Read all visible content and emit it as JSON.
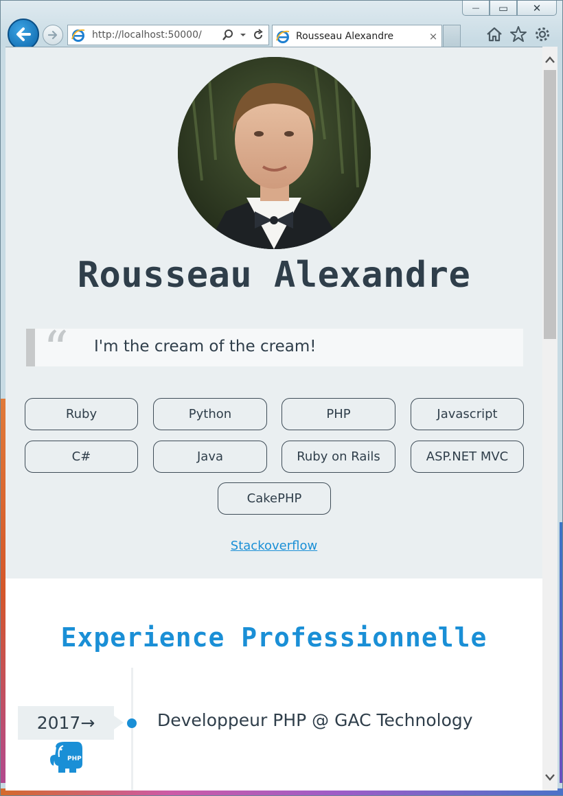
{
  "browser": {
    "url": "http://localhost:50000/",
    "tab_title": "Rousseau Alexandre",
    "tab_close": "×",
    "caption": {
      "minimize": "—",
      "maximize": "▭",
      "close": "✕"
    }
  },
  "profile": {
    "name": "Rousseau Alexandre",
    "quote_mark": "“",
    "quote": "I'm the cream of the cream!",
    "skills": [
      "Ruby",
      "Python",
      "PHP",
      "Javascript",
      "C#",
      "Java",
      "Ruby on Rails",
      "ASP.NET MVC",
      "CakePHP"
    ],
    "stackoverflow_link": "Stackoverflow"
  },
  "experience": {
    "title": "Experience Professionnelle",
    "items": [
      {
        "year": "2017→",
        "job": "Developpeur PHP @ GAC Technology",
        "logo": "php-elephant-icon"
      }
    ]
  },
  "colors": {
    "accent": "#1a8fd6",
    "text": "#2f3e4a",
    "page_bg": "#eaeff1",
    "section_bg": "#ffffff"
  }
}
